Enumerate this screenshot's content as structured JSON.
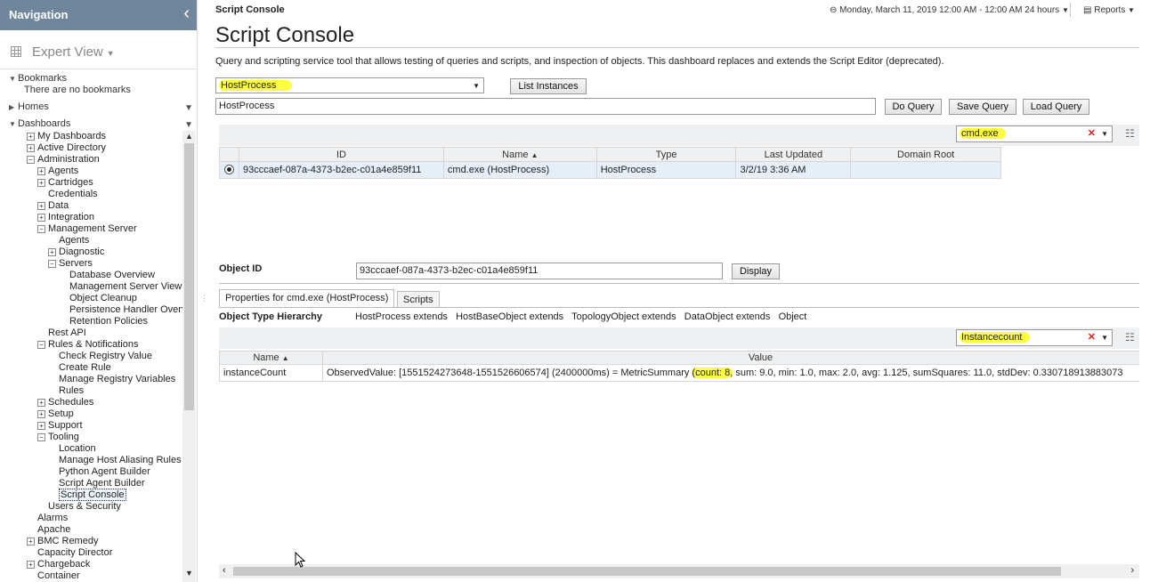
{
  "nav": {
    "title": "Navigation",
    "view_label": "Expert View",
    "bookmarks_label": "Bookmarks",
    "no_bookmarks": "There are no bookmarks",
    "homes_label": "Homes",
    "dashboards_label": "Dashboards",
    "tree": [
      {
        "label": "My Dashboards",
        "level": 1,
        "icon": "plus"
      },
      {
        "label": "Active Directory",
        "level": 1,
        "icon": "plus"
      },
      {
        "label": "Administration",
        "level": 1,
        "icon": "minus"
      },
      {
        "label": "Agents",
        "level": 2,
        "icon": "plus"
      },
      {
        "label": "Cartridges",
        "level": 2,
        "icon": "plus"
      },
      {
        "label": "Credentials",
        "level": 2,
        "icon": ""
      },
      {
        "label": "Data",
        "level": 2,
        "icon": "plus"
      },
      {
        "label": "Integration",
        "level": 2,
        "icon": "plus"
      },
      {
        "label": "Management Server",
        "level": 2,
        "icon": "minus"
      },
      {
        "label": "Agents",
        "level": 3,
        "icon": ""
      },
      {
        "label": "Diagnostic",
        "level": 3,
        "icon": "plus"
      },
      {
        "label": "Servers",
        "level": 3,
        "icon": "minus"
      },
      {
        "label": "Database Overview",
        "level": 4,
        "icon": ""
      },
      {
        "label": "Management Server View",
        "level": 4,
        "icon": ""
      },
      {
        "label": "Object Cleanup",
        "level": 4,
        "icon": ""
      },
      {
        "label": "Persistence Handler Overv",
        "level": 4,
        "icon": ""
      },
      {
        "label": "Retention Policies",
        "level": 4,
        "icon": ""
      },
      {
        "label": "Rest API",
        "level": 2,
        "icon": ""
      },
      {
        "label": "Rules & Notifications",
        "level": 2,
        "icon": "minus"
      },
      {
        "label": "Check Registry Value",
        "level": 3,
        "icon": ""
      },
      {
        "label": "Create Rule",
        "level": 3,
        "icon": ""
      },
      {
        "label": "Manage Registry Variables",
        "level": 3,
        "icon": ""
      },
      {
        "label": "Rules",
        "level": 3,
        "icon": ""
      },
      {
        "label": "Schedules",
        "level": 2,
        "icon": "plus"
      },
      {
        "label": "Setup",
        "level": 2,
        "icon": "plus"
      },
      {
        "label": "Support",
        "level": 2,
        "icon": "plus"
      },
      {
        "label": "Tooling",
        "level": 2,
        "icon": "minus"
      },
      {
        "label": "Location",
        "level": 3,
        "icon": ""
      },
      {
        "label": "Manage Host Aliasing Rules",
        "level": 3,
        "icon": ""
      },
      {
        "label": "Python Agent Builder",
        "level": 3,
        "icon": ""
      },
      {
        "label": "Script Agent Builder",
        "level": 3,
        "icon": ""
      },
      {
        "label": "Script Console",
        "level": 3,
        "icon": "",
        "selected": true
      },
      {
        "label": "Users & Security",
        "level": 2,
        "icon": ""
      },
      {
        "label": "Alarms",
        "level": 1,
        "icon": ""
      },
      {
        "label": "Apache",
        "level": 1,
        "icon": ""
      },
      {
        "label": "BMC Remedy",
        "level": 1,
        "icon": "plus"
      },
      {
        "label": "Capacity Director",
        "level": 1,
        "icon": ""
      },
      {
        "label": "Chargeback",
        "level": 1,
        "icon": "plus"
      },
      {
        "label": "Container",
        "level": 1,
        "icon": ""
      }
    ]
  },
  "header": {
    "breadcrumb": "Script Console",
    "date_range": "Monday, March 11, 2019 12:00 AM - 12:00 AM 24 hours",
    "reports_label": "Reports",
    "title": "Script Console",
    "description": "Query and scripting service tool that allows testing of queries and scripts, and inspection of objects. This dashboard replaces and extends the Script Editor (deprecated)."
  },
  "query": {
    "type_select": "HostProcess",
    "list_instances_label": "List Instances",
    "query_text": "HostProcess",
    "do_query_label": "Do Query",
    "save_query_label": "Save Query",
    "load_query_label": "Load Query",
    "filter_value": "cmd.exe"
  },
  "results": {
    "columns": [
      "ID",
      "Name",
      "Type",
      "Last Updated",
      "Domain Root"
    ],
    "rows": [
      [
        "93cccaef-087a-4373-b2ec-c01a4e859f11",
        "cmd.exe (HostProcess)",
        "HostProcess",
        "3/2/19 3:36 AM",
        ""
      ]
    ]
  },
  "object": {
    "id_label": "Object ID",
    "id_value": "93cccaef-087a-4373-b2ec-c01a4e859f11",
    "display_label": "Display",
    "tab_properties": "Properties for cmd.exe (HostProcess)",
    "tab_scripts": "Scripts",
    "hierarchy_label": "Object Type Hierarchy",
    "hierarchy": [
      "HostProcess extends",
      "HostBaseObject extends",
      "TopologyObject extends",
      "DataObject extends",
      "Object"
    ],
    "prop_filter": "Instancecount",
    "prop_columns": [
      "Name",
      "Value"
    ],
    "props": [
      {
        "name": "instanceCount",
        "value_pre": "ObservedValue: [1551524273648-1551526606574] (2400000ms) = MetricSummary ",
        "value_hl": "(count: 8,",
        "value_post": " sum: 9.0, min: 1.0, max: 2.0, avg: 1.125, sumSquares: 11.0, stdDev: 0.330718913883073"
      }
    ]
  }
}
